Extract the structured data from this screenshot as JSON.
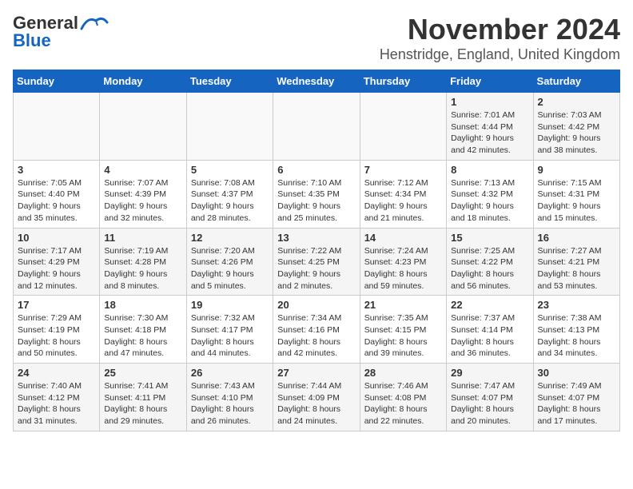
{
  "header": {
    "logo_general": "General",
    "logo_blue": "Blue",
    "month_title": "November 2024",
    "location": "Henstridge, England, United Kingdom"
  },
  "weekdays": [
    "Sunday",
    "Monday",
    "Tuesday",
    "Wednesday",
    "Thursday",
    "Friday",
    "Saturday"
  ],
  "weeks": [
    [
      {
        "day": "",
        "info": ""
      },
      {
        "day": "",
        "info": ""
      },
      {
        "day": "",
        "info": ""
      },
      {
        "day": "",
        "info": ""
      },
      {
        "day": "",
        "info": ""
      },
      {
        "day": "1",
        "info": "Sunrise: 7:01 AM\nSunset: 4:44 PM\nDaylight: 9 hours\nand 42 minutes."
      },
      {
        "day": "2",
        "info": "Sunrise: 7:03 AM\nSunset: 4:42 PM\nDaylight: 9 hours\nand 38 minutes."
      }
    ],
    [
      {
        "day": "3",
        "info": "Sunrise: 7:05 AM\nSunset: 4:40 PM\nDaylight: 9 hours\nand 35 minutes."
      },
      {
        "day": "4",
        "info": "Sunrise: 7:07 AM\nSunset: 4:39 PM\nDaylight: 9 hours\nand 32 minutes."
      },
      {
        "day": "5",
        "info": "Sunrise: 7:08 AM\nSunset: 4:37 PM\nDaylight: 9 hours\nand 28 minutes."
      },
      {
        "day": "6",
        "info": "Sunrise: 7:10 AM\nSunset: 4:35 PM\nDaylight: 9 hours\nand 25 minutes."
      },
      {
        "day": "7",
        "info": "Sunrise: 7:12 AM\nSunset: 4:34 PM\nDaylight: 9 hours\nand 21 minutes."
      },
      {
        "day": "8",
        "info": "Sunrise: 7:13 AM\nSunset: 4:32 PM\nDaylight: 9 hours\nand 18 minutes."
      },
      {
        "day": "9",
        "info": "Sunrise: 7:15 AM\nSunset: 4:31 PM\nDaylight: 9 hours\nand 15 minutes."
      }
    ],
    [
      {
        "day": "10",
        "info": "Sunrise: 7:17 AM\nSunset: 4:29 PM\nDaylight: 9 hours\nand 12 minutes."
      },
      {
        "day": "11",
        "info": "Sunrise: 7:19 AM\nSunset: 4:28 PM\nDaylight: 9 hours\nand 8 minutes."
      },
      {
        "day": "12",
        "info": "Sunrise: 7:20 AM\nSunset: 4:26 PM\nDaylight: 9 hours\nand 5 minutes."
      },
      {
        "day": "13",
        "info": "Sunrise: 7:22 AM\nSunset: 4:25 PM\nDaylight: 9 hours\nand 2 minutes."
      },
      {
        "day": "14",
        "info": "Sunrise: 7:24 AM\nSunset: 4:23 PM\nDaylight: 8 hours\nand 59 minutes."
      },
      {
        "day": "15",
        "info": "Sunrise: 7:25 AM\nSunset: 4:22 PM\nDaylight: 8 hours\nand 56 minutes."
      },
      {
        "day": "16",
        "info": "Sunrise: 7:27 AM\nSunset: 4:21 PM\nDaylight: 8 hours\nand 53 minutes."
      }
    ],
    [
      {
        "day": "17",
        "info": "Sunrise: 7:29 AM\nSunset: 4:19 PM\nDaylight: 8 hours\nand 50 minutes."
      },
      {
        "day": "18",
        "info": "Sunrise: 7:30 AM\nSunset: 4:18 PM\nDaylight: 8 hours\nand 47 minutes."
      },
      {
        "day": "19",
        "info": "Sunrise: 7:32 AM\nSunset: 4:17 PM\nDaylight: 8 hours\nand 44 minutes."
      },
      {
        "day": "20",
        "info": "Sunrise: 7:34 AM\nSunset: 4:16 PM\nDaylight: 8 hours\nand 42 minutes."
      },
      {
        "day": "21",
        "info": "Sunrise: 7:35 AM\nSunset: 4:15 PM\nDaylight: 8 hours\nand 39 minutes."
      },
      {
        "day": "22",
        "info": "Sunrise: 7:37 AM\nSunset: 4:14 PM\nDaylight: 8 hours\nand 36 minutes."
      },
      {
        "day": "23",
        "info": "Sunrise: 7:38 AM\nSunset: 4:13 PM\nDaylight: 8 hours\nand 34 minutes."
      }
    ],
    [
      {
        "day": "24",
        "info": "Sunrise: 7:40 AM\nSunset: 4:12 PM\nDaylight: 8 hours\nand 31 minutes."
      },
      {
        "day": "25",
        "info": "Sunrise: 7:41 AM\nSunset: 4:11 PM\nDaylight: 8 hours\nand 29 minutes."
      },
      {
        "day": "26",
        "info": "Sunrise: 7:43 AM\nSunset: 4:10 PM\nDaylight: 8 hours\nand 26 minutes."
      },
      {
        "day": "27",
        "info": "Sunrise: 7:44 AM\nSunset: 4:09 PM\nDaylight: 8 hours\nand 24 minutes."
      },
      {
        "day": "28",
        "info": "Sunrise: 7:46 AM\nSunset: 4:08 PM\nDaylight: 8 hours\nand 22 minutes."
      },
      {
        "day": "29",
        "info": "Sunrise: 7:47 AM\nSunset: 4:07 PM\nDaylight: 8 hours\nand 20 minutes."
      },
      {
        "day": "30",
        "info": "Sunrise: 7:49 AM\nSunset: 4:07 PM\nDaylight: 8 hours\nand 17 minutes."
      }
    ]
  ]
}
